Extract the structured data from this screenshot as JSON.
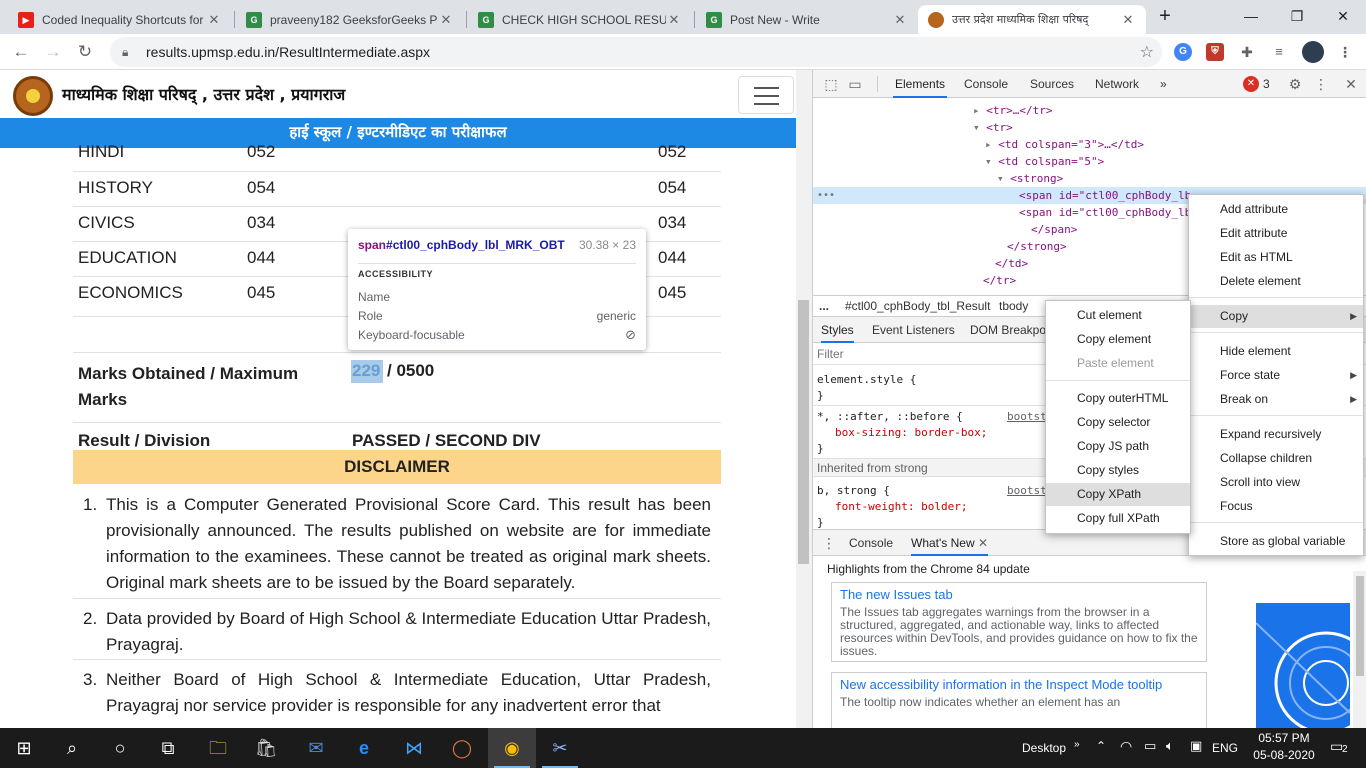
{
  "browser": {
    "tabs": [
      {
        "title": "Coded Inequality Shortcuts for",
        "favicon": "youtube-icon",
        "color": "#e62117"
      },
      {
        "title": "praveeny182 GeeksforGeeks P",
        "favicon": "gfg-icon",
        "color": "#2f8d46"
      },
      {
        "title": "CHECK HIGH SCHOOL RESULT",
        "favicon": "gfg-icon",
        "color": "#2f8d46"
      },
      {
        "title": "Post New - Write",
        "favicon": "gfg-icon",
        "color": "#2f8d46"
      },
      {
        "title": "उत्तर प्रदेश माध्यमिक शिक्षा परिषद्",
        "favicon": "upmsp-icon",
        "color": "#b5651d"
      }
    ],
    "new_tab": "+",
    "url": "results.upmsp.edu.in/ResultIntermediate.aspx"
  },
  "page": {
    "site_title": "माध्यमिक शिक्षा परिषद् , उत्तर प्रदेश , प्रयागराज",
    "banner": "हाई स्कूल / इण्टरमीडिएट का परीक्षाफल",
    "subjects": [
      {
        "name": "HINDI",
        "max": "052",
        "obt": "052"
      },
      {
        "name": "HISTORY",
        "max": "054",
        "obt": "054"
      },
      {
        "name": "CIVICS",
        "max": "034",
        "obt": "034"
      },
      {
        "name": "EDUCATION",
        "max": "044",
        "obt": "044"
      },
      {
        "name": "ECONOMICS",
        "max": "045",
        "obt": "045"
      }
    ],
    "total_label_1": "Marks Obtained / Maximum",
    "total_label_2": "Marks",
    "total_obtained": "229",
    "total_max": "/ 0500",
    "result_label": "Result / Division",
    "result_value": "PASSED / SECOND DIV",
    "disclaimer_title": "DISCLAIMER",
    "notes": [
      {
        "num": "1.",
        "text": "This is a Computer Generated Provisional Score Card. This result has been provisionally announced. The results published on website are for immediate information to the examinees. These cannot be treated as original mark sheets. Original mark sheets are to be issued by the Board separately."
      },
      {
        "num": "2.",
        "text": "Data provided by Board of High School & Intermediate Education Uttar Pradesh, Prayagraj."
      },
      {
        "num": "3.",
        "text": "Neither Board of High School & Intermediate Education, Uttar Pradesh, Prayagraj nor service provider is responsible for any inadvertent error that"
      }
    ]
  },
  "tooltip": {
    "tag": "span",
    "selector": "#ctl00_cphBody_lbl_MRK_OBT",
    "size": "30.38 × 23",
    "section": "ACCESSIBILITY",
    "rows": [
      {
        "label": "Name",
        "value": ""
      },
      {
        "label": "Role",
        "value": "generic"
      },
      {
        "label": "Keyboard-focusable",
        "value": ""
      }
    ]
  },
  "devtools": {
    "tabs": [
      "Elements",
      "Console",
      "Sources",
      "Network",
      "»"
    ],
    "issues_count": "3",
    "dom_lines": [
      "<tr>…</tr>",
      "<tr>",
      "<td colspan=\"3\">…</td>",
      "<td colspan=\"5\">",
      "<strong>",
      "<span id=\"ctl00_cphBody_lb",
      "<span id=\"ctl00_cphBody_lb",
      "</span>",
      "</strong>",
      "</td>",
      "</tr>"
    ],
    "breadcrumb_dots": "...",
    "breadcrumbs": [
      "#ctl00_cphBody_tbl_Result",
      "tbody"
    ],
    "styles_tabs": [
      "Styles",
      "Event Listeners",
      "DOM Breakpo"
    ],
    "filter_placeholder": "Filter",
    "styles_lines": [
      "element.style {",
      "}",
      "*, ::after, ::before {",
      "box-sizing: border-box;",
      "}",
      "Inherited from strong",
      "b, strong {",
      "font-weight: bolder;",
      "}"
    ],
    "styles_source": "bootst",
    "drawer_tabs": [
      "Console",
      "What's New"
    ],
    "whats_new_heading": "Highlights from the Chrome 84 update",
    "cards": [
      {
        "title": "The new Issues tab",
        "body": "The Issues tab aggregates warnings from the browser in a structured, aggregated, and actionable way, links to affected resources within DevTools, and provides guidance on how to fix the issues."
      },
      {
        "title": "New accessibility information in the Inspect Mode tooltip",
        "body": "The tooltip now indicates whether an element has an"
      }
    ]
  },
  "context_menu": {
    "items": [
      "Add attribute",
      "Edit attribute",
      "Edit as HTML",
      "Delete element",
      "Copy",
      "Hide element",
      "Force state",
      "Break on",
      "Expand recursively",
      "Collapse children",
      "Scroll into view",
      "Focus",
      "Store as global variable"
    ],
    "copy_submenu": [
      "Cut element",
      "Copy element",
      "Paste element",
      "Copy outerHTML",
      "Copy selector",
      "Copy JS path",
      "Copy styles",
      "Copy XPath",
      "Copy full XPath"
    ]
  },
  "taskbar": {
    "desktop": "Desktop",
    "lang": "ENG",
    "time": "05:57 PM",
    "date": "05-08-2020",
    "notifications": "2"
  }
}
